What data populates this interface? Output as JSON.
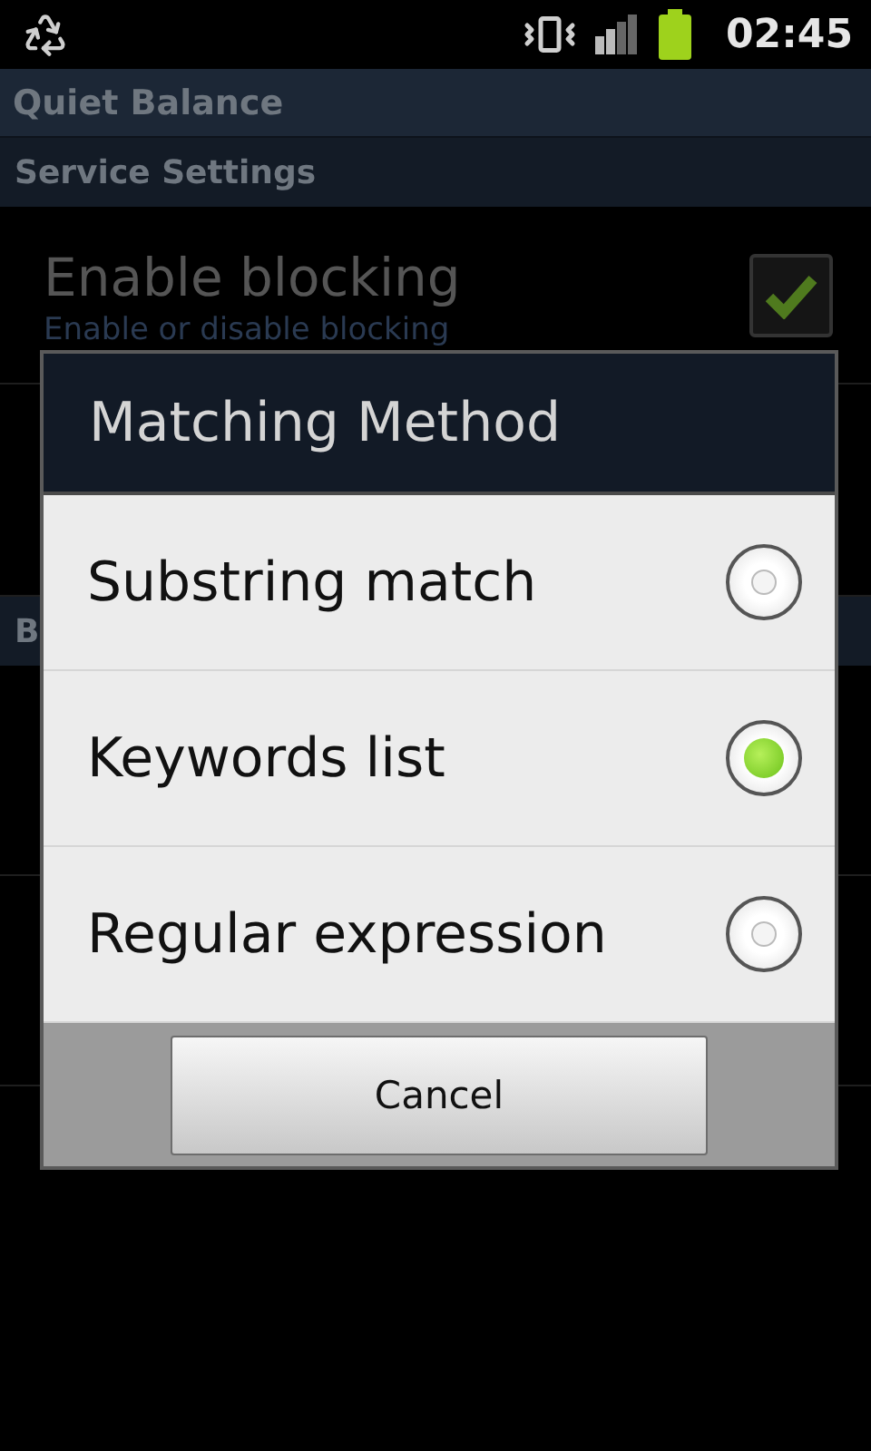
{
  "status_bar": {
    "time": "02:45"
  },
  "app_title": "Quiet Balance",
  "sections": [
    {
      "header": "Service Settings",
      "items": [
        {
          "title": "Enable blocking",
          "summary": "Enable or disable blocking",
          "checked": true
        }
      ]
    },
    {
      "header": "B"
    }
  ],
  "dialog": {
    "title": "Matching Method",
    "options": [
      {
        "label": "Substring match",
        "selected": false
      },
      {
        "label": "Keywords list",
        "selected": true
      },
      {
        "label": "Regular expression",
        "selected": false
      }
    ],
    "button": "Cancel"
  }
}
